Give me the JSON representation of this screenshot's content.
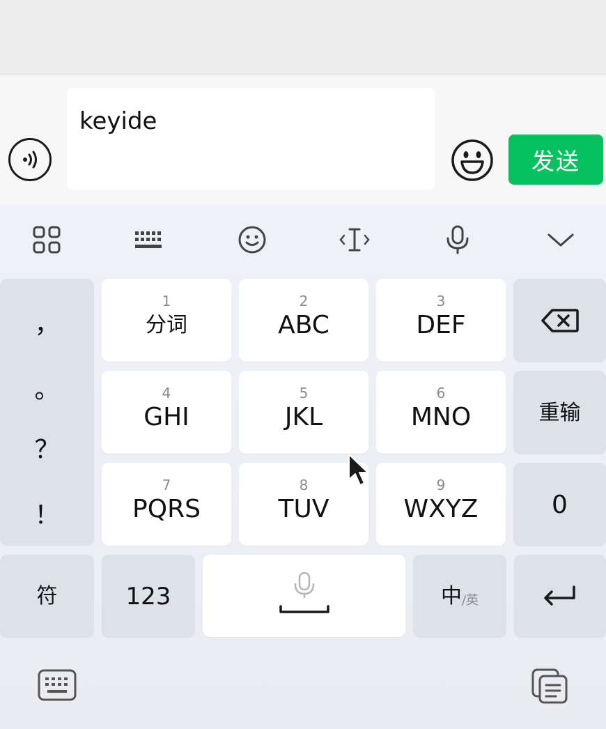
{
  "input": {
    "text": "keyide",
    "send_label": "发送"
  },
  "punctuation": [
    "，",
    "。",
    "？",
    "！"
  ],
  "keys": {
    "k1": {
      "num": "1",
      "label": "分词"
    },
    "k2": {
      "num": "2",
      "label": "ABC"
    },
    "k3": {
      "num": "3",
      "label": "DEF"
    },
    "k4": {
      "num": "4",
      "label": "GHI"
    },
    "k5": {
      "num": "5",
      "label": "JKL"
    },
    "k6": {
      "num": "6",
      "label": "MNO"
    },
    "k7": {
      "num": "7",
      "label": "PQRS"
    },
    "k8": {
      "num": "8",
      "label": "TUV"
    },
    "k9": {
      "num": "9",
      "label": "WXYZ"
    },
    "retype": "重输",
    "zero": "0",
    "symbol": "符",
    "numbers": "123",
    "lang_main": "中",
    "lang_sub": "/英"
  },
  "colors": {
    "send_green": "#07c160",
    "key_white": "#ffffff",
    "key_gray": "#dde1e8"
  }
}
